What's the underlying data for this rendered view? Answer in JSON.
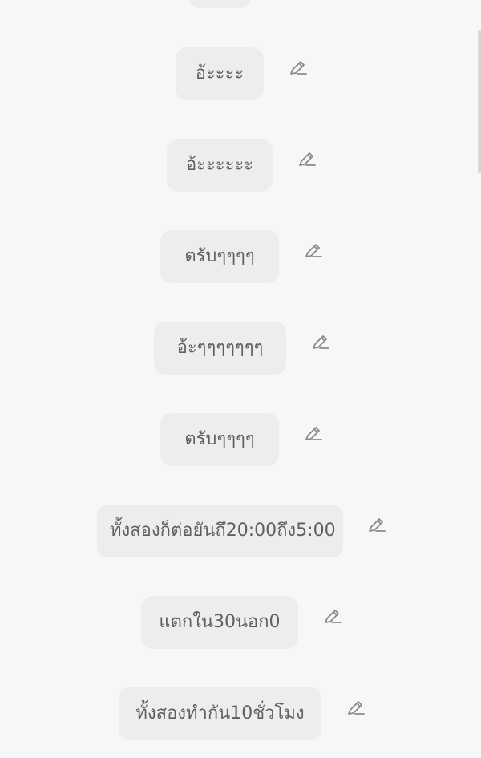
{
  "messages": [
    {
      "text": "อ้ะะะะ"
    },
    {
      "text": "อ้ะะะะะะ"
    },
    {
      "text": "ตรับๆๆๆๆ"
    },
    {
      "text": "อ้ะๆๆๆๆๆๆๆ"
    },
    {
      "text": "ตรับๆๆๆๆ"
    },
    {
      "text": "ทั้งสองก็ต่อยันถึ20:00ถึง5:00"
    },
    {
      "text": "แตกใน30นอก0"
    },
    {
      "text": "ทั้งสองทำกัน10ชั่วโมง"
    }
  ],
  "icons": {
    "edit": "edit-pencil-icon"
  },
  "colors": {
    "background": "#f7f7f7",
    "bubble": "#ededed",
    "text": "#5f5f5f",
    "icon": "#8a8a8a"
  }
}
